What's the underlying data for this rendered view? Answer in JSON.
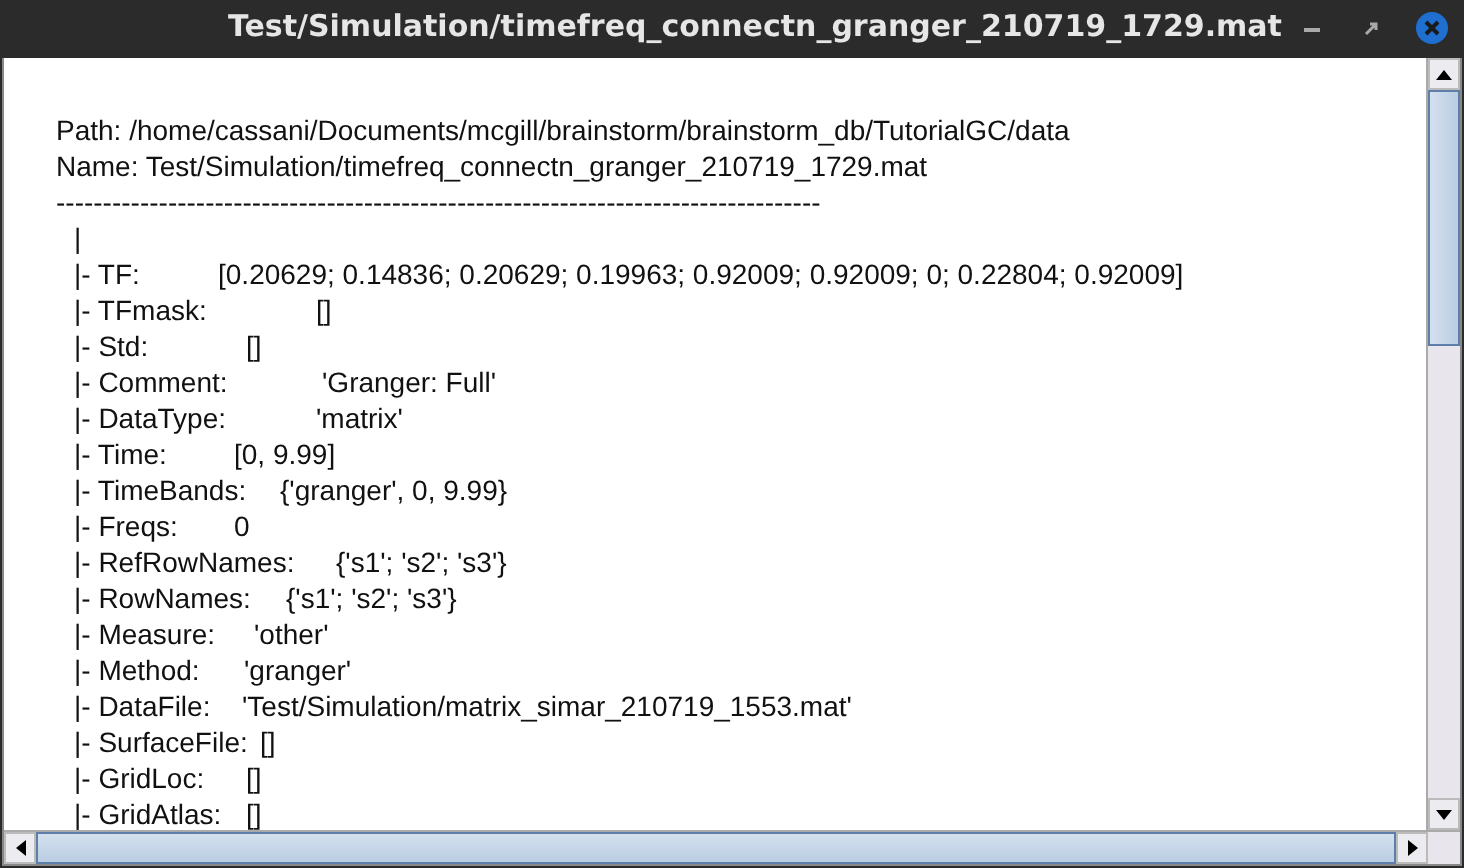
{
  "window": {
    "title": "Test/Simulation/timefreq_connectn_granger_210719_1729.mat"
  },
  "header": {
    "path": "Path: /home/cassani/Documents/mcgill/brainstorm/brainstorm_db/TutorialGC/data",
    "name": "Name: Test/Simulation/timefreq_connectn_granger_210719_1729.mat",
    "separator": "----------------------------------------------------------------------------------",
    "root": "|"
  },
  "fields": [
    {
      "label": "|- TF:",
      "value": "[0.20629; 0.14836; 0.20629; 0.19963; 0.92009; 0.92009; 0; 0.22804; 0.92009]"
    },
    {
      "label": "|- TFmask:",
      "value": "[]"
    },
    {
      "label": "|- Std:",
      "value": "[]"
    },
    {
      "label": "|- Comment:",
      "value": "'Granger: Full'"
    },
    {
      "label": "|- DataType:",
      "value": "'matrix'"
    },
    {
      "label": "|- Time:",
      "value": "[0, 9.99]"
    },
    {
      "label": "|- TimeBands:",
      "value": "{'granger', 0, 9.99}"
    },
    {
      "label": "|- Freqs:",
      "value": "0"
    },
    {
      "label": "|- RefRowNames:",
      "value": "{'s1'; 's2'; 's3'}"
    },
    {
      "label": "|- RowNames:",
      "value": "{'s1'; 's2'; 's3'}"
    },
    {
      "label": "|- Measure:",
      "value": "'other'"
    },
    {
      "label": "|- Method:",
      "value": "'granger'"
    },
    {
      "label": "|- DataFile:",
      "value": "'Test/Simulation/matrix_simar_210719_1553.mat'"
    },
    {
      "label": "|- SurfaceFile:",
      "value": "[]"
    },
    {
      "label": "|- GridLoc:",
      "value": "[]"
    },
    {
      "label": "|- GridAtlas:",
      "value": "[]"
    }
  ]
}
